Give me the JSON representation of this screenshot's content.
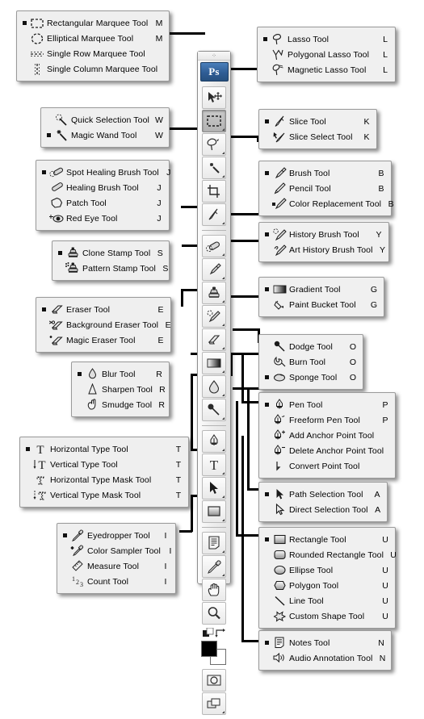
{
  "toolbox": {
    "app_logo": "Ps",
    "grip": "⁘",
    "buttons": [
      {
        "name": "move-tool",
        "selected": false,
        "flyout": false
      },
      {
        "name": "rectangular-marquee-tool",
        "selected": true,
        "flyout": true
      },
      {
        "name": "lasso-tool",
        "selected": false,
        "flyout": true
      },
      {
        "name": "magic-wand-tool",
        "selected": false,
        "flyout": true
      },
      {
        "name": "crop-tool",
        "selected": false,
        "flyout": false
      },
      {
        "name": "slice-tool",
        "selected": false,
        "flyout": true
      },
      {
        "name": "spot-healing-brush-tool",
        "selected": false,
        "flyout": true
      },
      {
        "name": "brush-tool",
        "selected": false,
        "flyout": true
      },
      {
        "name": "clone-stamp-tool",
        "selected": false,
        "flyout": true
      },
      {
        "name": "history-brush-tool",
        "selected": false,
        "flyout": true
      },
      {
        "name": "eraser-tool",
        "selected": false,
        "flyout": true
      },
      {
        "name": "gradient-tool",
        "selected": false,
        "flyout": true
      },
      {
        "name": "blur-tool",
        "selected": false,
        "flyout": true
      },
      {
        "name": "dodge-tool",
        "selected": false,
        "flyout": true
      },
      {
        "name": "pen-tool",
        "selected": false,
        "flyout": true
      },
      {
        "name": "horizontal-type-tool",
        "selected": false,
        "flyout": true
      },
      {
        "name": "path-selection-tool",
        "selected": false,
        "flyout": true
      },
      {
        "name": "rectangle-tool",
        "selected": false,
        "flyout": true
      },
      {
        "name": "notes-tool",
        "selected": false,
        "flyout": true
      },
      {
        "name": "eyedropper-tool",
        "selected": false,
        "flyout": true
      },
      {
        "name": "hand-tool",
        "selected": false,
        "flyout": false
      },
      {
        "name": "zoom-tool",
        "selected": false,
        "flyout": false
      }
    ],
    "quick_mask": "quick-mask-mode",
    "screen_mode": "screen-mode"
  },
  "panels": [
    {
      "id": "marquee",
      "items": [
        {
          "label": "Rectangular Marquee Tool",
          "key": "M",
          "icon": "rectangular-marquee-icon",
          "selected": true
        },
        {
          "label": "Elliptical Marquee Tool",
          "key": "M",
          "icon": "elliptical-marquee-icon",
          "selected": false
        },
        {
          "label": "Single Row Marquee Tool",
          "key": "",
          "icon": "single-row-marquee-icon",
          "selected": false
        },
        {
          "label": "Single Column Marquee Tool",
          "key": "",
          "icon": "single-column-marquee-icon",
          "selected": false
        }
      ]
    },
    {
      "id": "lasso",
      "items": [
        {
          "label": "Lasso Tool",
          "key": "L",
          "icon": "lasso-icon",
          "selected": true
        },
        {
          "label": "Polygonal Lasso Tool",
          "key": "L",
          "icon": "polygonal-lasso-icon",
          "selected": false
        },
        {
          "label": "Magnetic Lasso Tool",
          "key": "L",
          "icon": "magnetic-lasso-icon",
          "selected": false
        }
      ]
    },
    {
      "id": "wand",
      "items": [
        {
          "label": "Quick Selection Tool",
          "key": "W",
          "icon": "quick-selection-icon",
          "selected": false
        },
        {
          "label": "Magic Wand Tool",
          "key": "W",
          "icon": "magic-wand-icon",
          "selected": true
        }
      ]
    },
    {
      "id": "slice",
      "items": [
        {
          "label": "Slice Tool",
          "key": "K",
          "icon": "slice-icon",
          "selected": true
        },
        {
          "label": "Slice Select Tool",
          "key": "K",
          "icon": "slice-select-icon",
          "selected": false
        }
      ]
    },
    {
      "id": "healing",
      "items": [
        {
          "label": "Spot Healing Brush Tool",
          "key": "J",
          "icon": "spot-healing-brush-icon",
          "selected": true
        },
        {
          "label": "Healing Brush Tool",
          "key": "J",
          "icon": "healing-brush-icon",
          "selected": false
        },
        {
          "label": "Patch Tool",
          "key": "J",
          "icon": "patch-icon",
          "selected": false
        },
        {
          "label": "Red Eye Tool",
          "key": "J",
          "icon": "red-eye-icon",
          "selected": false
        }
      ]
    },
    {
      "id": "brush",
      "items": [
        {
          "label": "Brush Tool",
          "key": "B",
          "icon": "brush-icon",
          "selected": true
        },
        {
          "label": "Pencil Tool",
          "key": "B",
          "icon": "pencil-icon",
          "selected": false
        },
        {
          "label": "Color Replacement Tool",
          "key": "B",
          "icon": "color-replacement-icon",
          "selected": false
        }
      ]
    },
    {
      "id": "stamp",
      "items": [
        {
          "label": "Clone Stamp Tool",
          "key": "S",
          "icon": "clone-stamp-icon",
          "selected": true
        },
        {
          "label": "Pattern Stamp Tool",
          "key": "S",
          "icon": "pattern-stamp-icon",
          "selected": false
        }
      ]
    },
    {
      "id": "history",
      "items": [
        {
          "label": "History Brush Tool",
          "key": "Y",
          "icon": "history-brush-icon",
          "selected": true
        },
        {
          "label": "Art History Brush Tool",
          "key": "Y",
          "icon": "art-history-brush-icon",
          "selected": false
        }
      ]
    },
    {
      "id": "eraser",
      "items": [
        {
          "label": "Eraser Tool",
          "key": "E",
          "icon": "eraser-icon",
          "selected": true
        },
        {
          "label": "Background Eraser Tool",
          "key": "E",
          "icon": "background-eraser-icon",
          "selected": false
        },
        {
          "label": "Magic Eraser Tool",
          "key": "E",
          "icon": "magic-eraser-icon",
          "selected": false
        }
      ]
    },
    {
      "id": "gradient",
      "items": [
        {
          "label": "Gradient Tool",
          "key": "G",
          "icon": "gradient-icon",
          "selected": true
        },
        {
          "label": "Paint Bucket Tool",
          "key": "G",
          "icon": "paint-bucket-icon",
          "selected": false
        }
      ]
    },
    {
      "id": "blur",
      "items": [
        {
          "label": "Blur Tool",
          "key": "R",
          "icon": "blur-icon",
          "selected": true
        },
        {
          "label": "Sharpen Tool",
          "key": "R",
          "icon": "sharpen-icon",
          "selected": false
        },
        {
          "label": "Smudge Tool",
          "key": "R",
          "icon": "smudge-icon",
          "selected": false
        }
      ]
    },
    {
      "id": "dodge",
      "items": [
        {
          "label": "Dodge Tool",
          "key": "O",
          "icon": "dodge-icon",
          "selected": false
        },
        {
          "label": "Burn Tool",
          "key": "O",
          "icon": "burn-icon",
          "selected": false
        },
        {
          "label": "Sponge Tool",
          "key": "O",
          "icon": "sponge-icon",
          "selected": true
        }
      ]
    },
    {
      "id": "pen",
      "items": [
        {
          "label": "Pen Tool",
          "key": "P",
          "icon": "pen-icon",
          "selected": true
        },
        {
          "label": "Freeform Pen Tool",
          "key": "P",
          "icon": "freeform-pen-icon",
          "selected": false
        },
        {
          "label": "Add Anchor Point Tool",
          "key": "",
          "icon": "add-anchor-point-icon",
          "selected": false
        },
        {
          "label": "Delete Anchor Point Tool",
          "key": "",
          "icon": "delete-anchor-point-icon",
          "selected": false
        },
        {
          "label": "Convert Point Tool",
          "key": "",
          "icon": "convert-point-icon",
          "selected": false
        }
      ]
    },
    {
      "id": "type",
      "items": [
        {
          "label": "Horizontal Type Tool",
          "key": "T",
          "icon": "horizontal-type-icon",
          "selected": true
        },
        {
          "label": "Vertical Type Tool",
          "key": "T",
          "icon": "vertical-type-icon",
          "selected": false
        },
        {
          "label": "Horizontal Type Mask Tool",
          "key": "T",
          "icon": "horizontal-type-mask-icon",
          "selected": false
        },
        {
          "label": "Vertical Type Mask Tool",
          "key": "T",
          "icon": "vertical-type-mask-icon",
          "selected": false
        }
      ]
    },
    {
      "id": "pathsel",
      "items": [
        {
          "label": "Path Selection Tool",
          "key": "A",
          "icon": "path-selection-icon",
          "selected": true
        },
        {
          "label": "Direct Selection Tool",
          "key": "A",
          "icon": "direct-selection-icon",
          "selected": false
        }
      ]
    },
    {
      "id": "shape",
      "items": [
        {
          "label": "Rectangle Tool",
          "key": "U",
          "icon": "rectangle-icon",
          "selected": true
        },
        {
          "label": "Rounded Rectangle Tool",
          "key": "U",
          "icon": "rounded-rectangle-icon",
          "selected": false
        },
        {
          "label": "Ellipse Tool",
          "key": "U",
          "icon": "ellipse-icon",
          "selected": false
        },
        {
          "label": "Polygon Tool",
          "key": "U",
          "icon": "polygon-icon",
          "selected": false
        },
        {
          "label": "Line Tool",
          "key": "U",
          "icon": "line-icon",
          "selected": false
        },
        {
          "label": "Custom Shape Tool",
          "key": "U",
          "icon": "custom-shape-icon",
          "selected": false
        }
      ]
    },
    {
      "id": "eyedropper",
      "items": [
        {
          "label": "Eyedropper Tool",
          "key": "I",
          "icon": "eyedropper-icon",
          "selected": true
        },
        {
          "label": "Color Sampler Tool",
          "key": "I",
          "icon": "color-sampler-icon",
          "selected": false
        },
        {
          "label": "Measure Tool",
          "key": "I",
          "icon": "measure-icon",
          "selected": false
        },
        {
          "label": "Count Tool",
          "key": "I",
          "icon": "count-icon",
          "selected": false
        }
      ]
    },
    {
      "id": "notes",
      "items": [
        {
          "label": "Notes Tool",
          "key": "N",
          "icon": "notes-icon",
          "selected": true
        },
        {
          "label": "Audio Annotation Tool",
          "key": "N",
          "icon": "audio-annotation-icon",
          "selected": false
        }
      ]
    }
  ]
}
